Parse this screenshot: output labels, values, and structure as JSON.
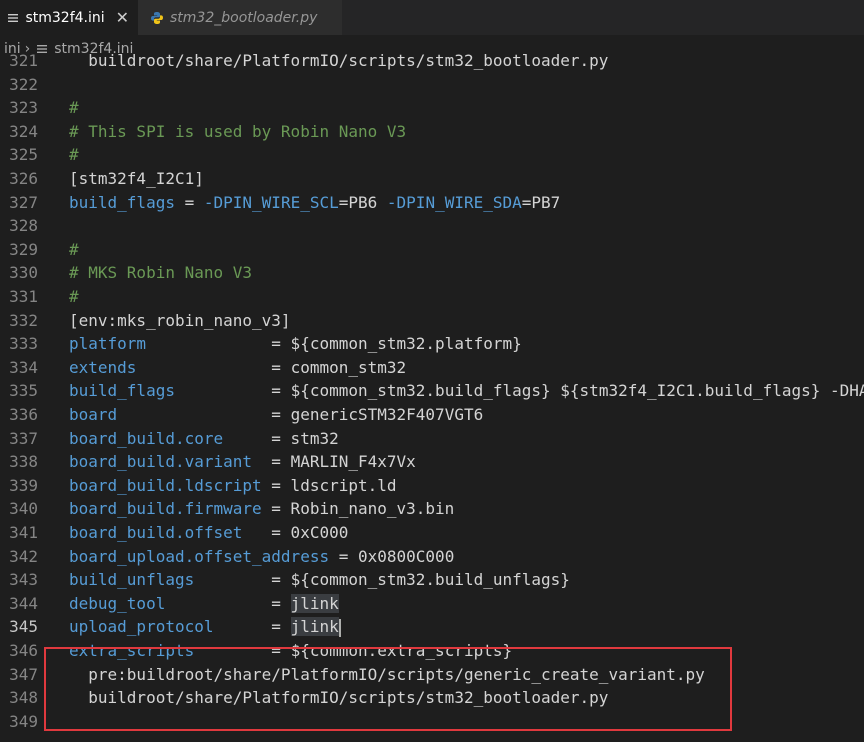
{
  "tabs": [
    {
      "label": "stm32f4.ini",
      "icon": "ini-file-icon",
      "active": true,
      "close": "✕"
    },
    {
      "label": "stm32_bootloader.py",
      "icon": "python-icon",
      "active": false
    }
  ],
  "breadcrumb": {
    "folder": "ini",
    "file": "stm32f4.ini"
  },
  "lines": [
    {
      "n": "321",
      "parts": [
        [
          "p",
          "  buildroot/share/PlatformIO/scripts/stm32_bootloader.py"
        ]
      ]
    },
    {
      "n": "322",
      "parts": []
    },
    {
      "n": "323",
      "parts": [
        [
          "c",
          "#"
        ]
      ]
    },
    {
      "n": "324",
      "parts": [
        [
          "c",
          "# This SPI is used by Robin Nano V3"
        ]
      ]
    },
    {
      "n": "325",
      "parts": [
        [
          "c",
          "#"
        ]
      ]
    },
    {
      "n": "326",
      "parts": [
        [
          "p",
          "[stm32f4_I2C1]"
        ]
      ]
    },
    {
      "n": "327",
      "parts": [
        [
          "k",
          "build_flags"
        ],
        [
          "p",
          " = "
        ],
        [
          "k",
          "-DPIN_WIRE_SCL"
        ],
        [
          "p",
          "=PB6 "
        ],
        [
          "k",
          "-DPIN_WIRE_SDA"
        ],
        [
          "p",
          "=PB7"
        ]
      ]
    },
    {
      "n": "328",
      "parts": []
    },
    {
      "n": "329",
      "parts": [
        [
          "c",
          "#"
        ]
      ]
    },
    {
      "n": "330",
      "parts": [
        [
          "c",
          "# MKS Robin Nano V3"
        ]
      ]
    },
    {
      "n": "331",
      "parts": [
        [
          "c",
          "#"
        ]
      ]
    },
    {
      "n": "332",
      "parts": [
        [
          "p",
          "[env:mks_robin_nano_v3]"
        ]
      ]
    },
    {
      "n": "333",
      "parts": [
        [
          "k",
          "platform"
        ],
        [
          "p",
          "             = ${common_stm32.platform}"
        ]
      ]
    },
    {
      "n": "334",
      "parts": [
        [
          "k",
          "extends"
        ],
        [
          "p",
          "              = common_stm32"
        ]
      ]
    },
    {
      "n": "335",
      "parts": [
        [
          "k",
          "build_flags"
        ],
        [
          "p",
          "          = ${common_stm32.build_flags} ${stm32f4_I2C1.build_flags} -DHA"
        ]
      ]
    },
    {
      "n": "336",
      "parts": [
        [
          "k",
          "board"
        ],
        [
          "p",
          "                = genericSTM32F407VGT6"
        ]
      ]
    },
    {
      "n": "337",
      "parts": [
        [
          "k",
          "board_build.core"
        ],
        [
          "p",
          "     = stm32"
        ]
      ]
    },
    {
      "n": "338",
      "parts": [
        [
          "k",
          "board_build.variant"
        ],
        [
          "p",
          "  = MARLIN_F4x7Vx"
        ]
      ]
    },
    {
      "n": "339",
      "parts": [
        [
          "k",
          "board_build.ldscript"
        ],
        [
          "p",
          " = ldscript.ld"
        ]
      ]
    },
    {
      "n": "340",
      "parts": [
        [
          "k",
          "board_build.firmware"
        ],
        [
          "p",
          " = Robin_nano_v3.bin"
        ]
      ]
    },
    {
      "n": "341",
      "parts": [
        [
          "k",
          "board_build.offset"
        ],
        [
          "p",
          "   = 0xC000"
        ]
      ]
    },
    {
      "n": "342",
      "parts": [
        [
          "k",
          "board_upload.offset_address"
        ],
        [
          "p",
          " = 0x0800C000"
        ]
      ]
    },
    {
      "n": "343",
      "parts": [
        [
          "k",
          "build_unflags"
        ],
        [
          "p",
          "        = ${common_stm32.build_unflags}"
        ]
      ]
    },
    {
      "n": "344",
      "parts": [
        [
          "k",
          "debug_tool"
        ],
        [
          "p",
          "           = "
        ],
        [
          "h",
          "jlink"
        ]
      ]
    },
    {
      "n": "345",
      "parts": [
        [
          "k",
          "upload_protocol"
        ],
        [
          "p",
          "      = "
        ],
        [
          "h",
          "jlink"
        ]
      ],
      "current": true
    },
    {
      "n": "346",
      "parts": [
        [
          "k",
          "extra_scripts"
        ],
        [
          "p",
          "        = ${common.extra_scripts}"
        ]
      ]
    },
    {
      "n": "347",
      "parts": [
        [
          "p",
          "  pre:buildroot/share/PlatformIO/scripts/generic_create_variant.py"
        ]
      ]
    },
    {
      "n": "348",
      "parts": [
        [
          "p",
          "  buildroot/share/PlatformIO/scripts/stm32_bootloader.py"
        ]
      ]
    },
    {
      "n": "349",
      "parts": []
    }
  ]
}
